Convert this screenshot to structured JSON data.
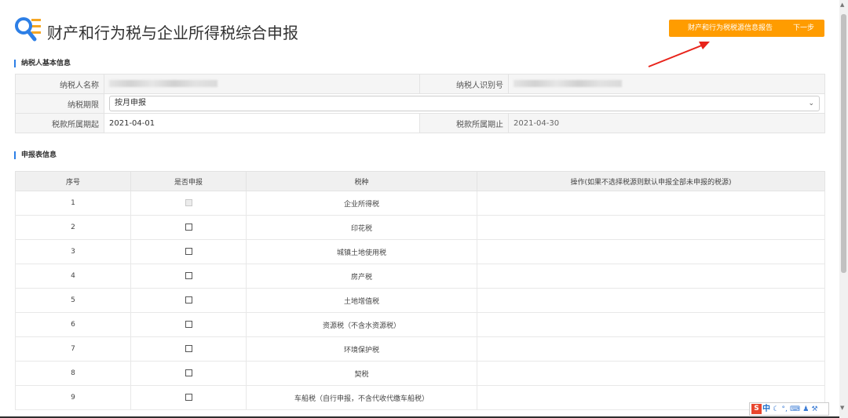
{
  "header": {
    "title": "财产和行为税与企业所得税综合申报",
    "report_button": "财产和行为税税源信息报告",
    "next_button": "下一步"
  },
  "basic_info": {
    "section_title": "纳税人基本信息",
    "taxpayer_name_label": "纳税人名称",
    "taxpayer_id_label": "纳税人识别号",
    "period_label": "纳税期限",
    "period_value": "按月申报",
    "start_label": "税款所属期起",
    "start_value": "2021-04-01",
    "end_label": "税款所属期止",
    "end_value": "2021-04-30"
  },
  "declaration": {
    "section_title": "申报表信息",
    "columns": [
      "序号",
      "是否申报",
      "税种",
      "操作(如果不选择税源则默认申报全部未申报的税源)"
    ],
    "rows": [
      {
        "no": "1",
        "tax": "企业所得税",
        "disabled": true
      },
      {
        "no": "2",
        "tax": "印花税",
        "disabled": false
      },
      {
        "no": "3",
        "tax": "城镇土地使用税",
        "disabled": false
      },
      {
        "no": "4",
        "tax": "房产税",
        "disabled": false
      },
      {
        "no": "5",
        "tax": "土地增值税",
        "disabled": false
      },
      {
        "no": "6",
        "tax": "资源税（不含水资源税）",
        "disabled": false
      },
      {
        "no": "7",
        "tax": "环境保护税",
        "disabled": false
      },
      {
        "no": "8",
        "tax": "契税",
        "disabled": false
      },
      {
        "no": "9",
        "tax": "车船税（自行申报，不含代收代缴车船税）",
        "disabled": false
      }
    ]
  },
  "ime": {
    "label": "中",
    "brand": "S"
  },
  "colors": {
    "accent": "#ff9c00",
    "section_marker": "#2d7fe6",
    "arrow": "#e8231a"
  }
}
